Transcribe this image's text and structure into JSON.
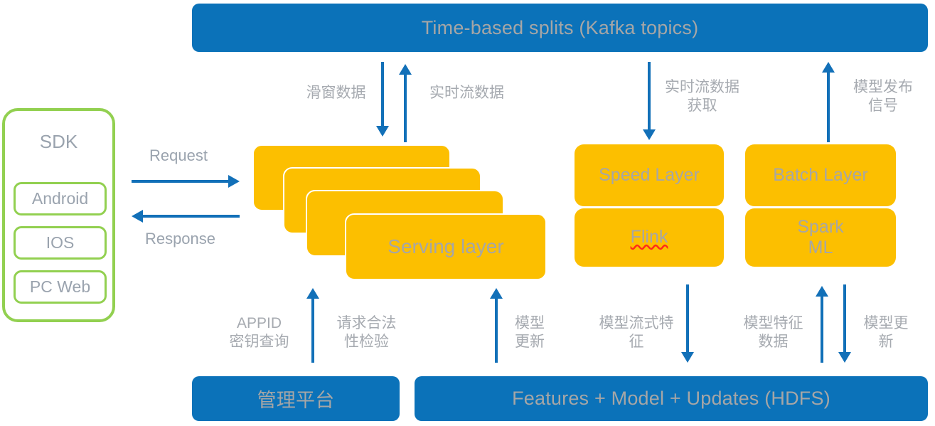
{
  "diagram": {
    "title_banner": "Time-based splits (Kafka topics)",
    "sdk": {
      "title": "SDK",
      "items": [
        "Android",
        "IOS",
        "PC Web"
      ]
    },
    "serving": {
      "label": "Serving layer",
      "stack_count": 4
    },
    "speed": {
      "title": "Speed Layer",
      "engine": "Flink"
    },
    "batch": {
      "title": "Batch Layer",
      "engine": "Spark\nML"
    },
    "bottom": {
      "admin": "管理平台",
      "storage": "Features + Model + Updates (HDFS)"
    },
    "flows": {
      "request": "Request",
      "response": "Response",
      "sliding_window": "滑窗数据",
      "realtime_stream": "实时流数据",
      "realtime_stream_fetch": "实时流数据\n获取",
      "model_publish_signal": "模型发布\n信号",
      "appid_key_query": "APPID\n密钥查询",
      "request_legality_check": "请求合法\n性检验",
      "model_update_serving": "模型\n更新",
      "model_stream_feature": "模型流式特\n征",
      "model_feature_data": "模型特征\n数据",
      "model_update_batch": "模型更\n新"
    },
    "colors": {
      "blue": "#0B72B9",
      "amber": "#FCBF00",
      "green": "#92D050",
      "arrow_blue": "#1270B8",
      "text_gray": "#A6A6A6"
    }
  }
}
